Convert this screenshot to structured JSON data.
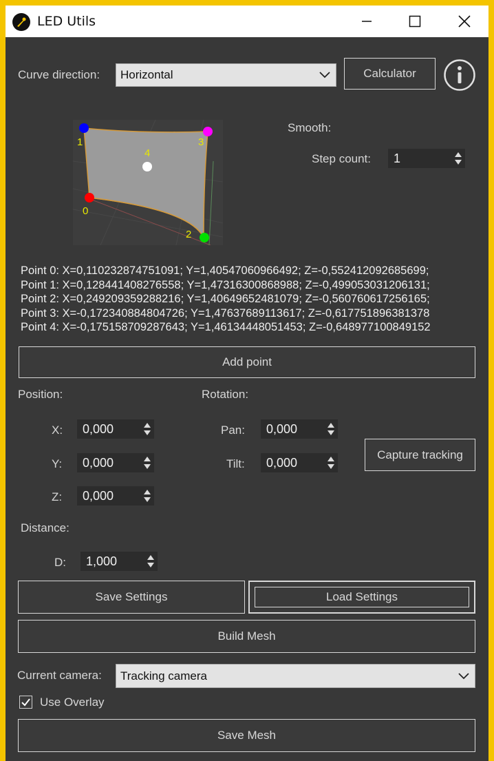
{
  "window": {
    "title": "LED Utils",
    "accent_color": "#f4c400",
    "background_color": "#383838"
  },
  "curve_direction": {
    "label": "Curve direction:",
    "value": "Horizontal"
  },
  "buttons": {
    "calculator": "Calculator",
    "info_icon": "info-icon",
    "add_point": "Add point",
    "capture_tracking": "Capture tracking",
    "save_settings": "Save Settings",
    "load_settings": "Load Settings",
    "build_mesh": "Build Mesh",
    "save_mesh": "Save Mesh"
  },
  "preview": {
    "markers": [
      "1",
      "3",
      "4",
      "0",
      "2"
    ],
    "marker_colors": {
      "0": "#ff0000",
      "1": "#0000ff",
      "2": "#00e000",
      "3": "#ff00ff",
      "4": "#ffffff"
    }
  },
  "smooth": {
    "label": "Smooth:",
    "step_count_label": "Step count:",
    "step_count_value": "1"
  },
  "points": [
    "Point 0:  X=0,110232874751091; Y=1,40547060966492; Z=-0,552412092685699;",
    "Point 1:  X=0,128441408276558; Y=1,47316300868988; Z=-0,499053031206131;",
    "Point 2:  X=0,249209359288216; Y=1,40649652481079; Z=-0,560760617256165;",
    "Point 3:  X=-0,172340884804726; Y=1,47637689113617; Z=-0,617751896381378",
    "Point 4:  X=-0,175158709287643; Y=1,46134448051453; Z=-0,648977100849152"
  ],
  "position": {
    "label": "Position:",
    "x_label": "X:",
    "x_value": "0,000",
    "y_label": "Y:",
    "y_value": "0,000",
    "z_label": "Z:",
    "z_value": "0,000"
  },
  "rotation": {
    "label": "Rotation:",
    "pan_label": "Pan:",
    "pan_value": "0,000",
    "tilt_label": "Tilt:",
    "tilt_value": "0,000"
  },
  "distance": {
    "label": "Distance:",
    "d_label": "D:",
    "d_value": "1,000"
  },
  "camera": {
    "label": "Current camera:",
    "value": "Tracking camera"
  },
  "overlay": {
    "label": "Use Overlay",
    "checked": true
  }
}
